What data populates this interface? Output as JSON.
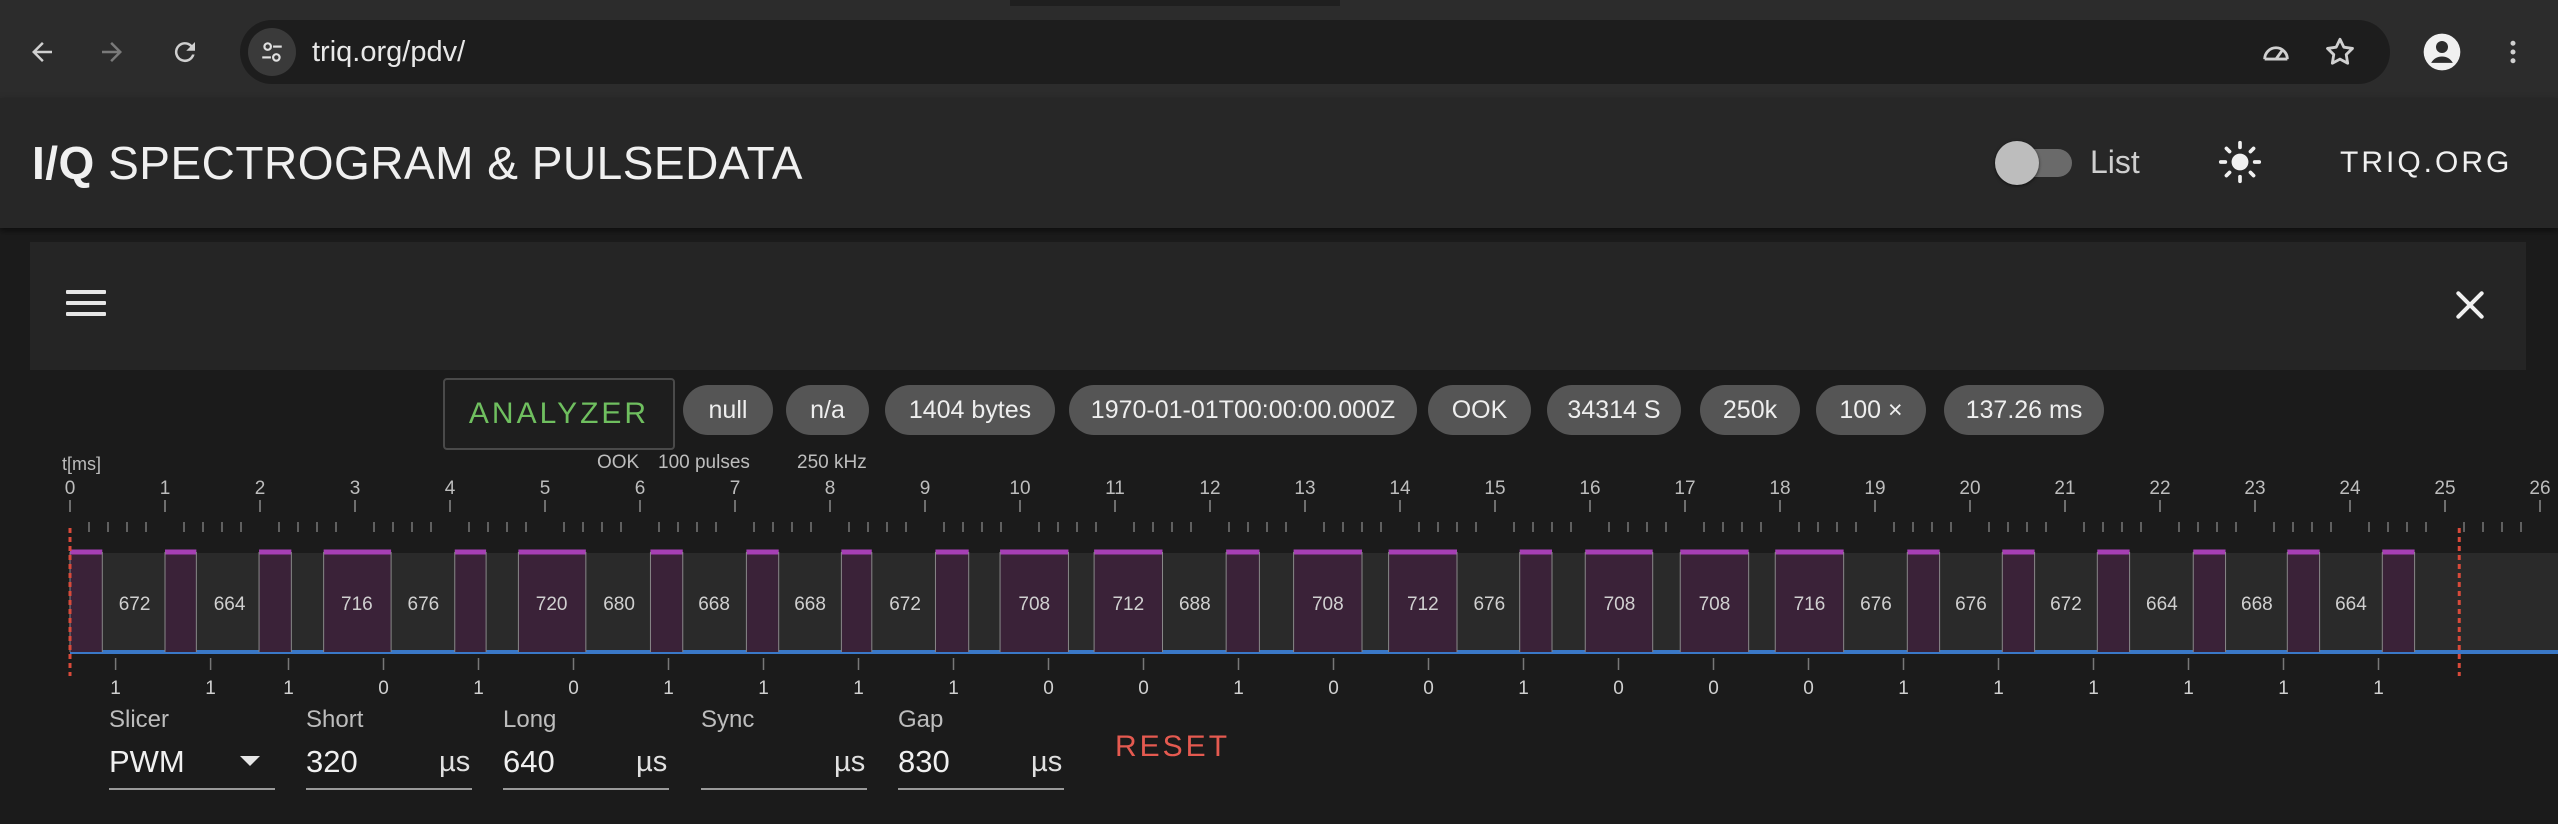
{
  "browser": {
    "url": "triq.org/pdv/"
  },
  "app": {
    "title_bold": "I/Q",
    "title_rest": " SPECTROGRAM & PULSEDATA",
    "list_label": "List",
    "brand": "TRIQ.ORG"
  },
  "analyzer": {
    "label": "ANALYZER"
  },
  "chips": [
    "null",
    "n/a",
    "1404 bytes",
    "1970-01-01T00:00:00.000Z",
    "OOK",
    "34314 S",
    "250k",
    "100 ×",
    "137.26 ms"
  ],
  "chart_header": {
    "axis_label": "t[ms]",
    "modulation": "OOK",
    "pulses": "100 pulses",
    "rate": "250 kHz"
  },
  "chart_data": {
    "type": "timeline",
    "xlabel": "t[ms]",
    "xlim": [
      0,
      26
    ],
    "ticks": [
      "0",
      "1",
      "2",
      "3",
      "4",
      "5",
      "6",
      "7",
      "8",
      "9",
      "10",
      "11",
      "12",
      "13",
      "14",
      "15",
      "16",
      "17",
      "18",
      "19",
      "20",
      "21",
      "22",
      "23",
      "24",
      "25",
      "26"
    ],
    "pulses": [
      {
        "start": 0.0,
        "end": 0.34
      },
      {
        "start": 1.0,
        "end": 1.33
      },
      {
        "start": 1.99,
        "end": 2.33
      },
      {
        "start": 2.67,
        "end": 3.38
      },
      {
        "start": 4.05,
        "end": 4.38
      },
      {
        "start": 4.72,
        "end": 5.43
      },
      {
        "start": 6.11,
        "end": 6.45
      },
      {
        "start": 7.12,
        "end": 7.46
      },
      {
        "start": 8.12,
        "end": 8.44
      },
      {
        "start": 9.11,
        "end": 9.46
      },
      {
        "start": 9.79,
        "end": 10.51
      },
      {
        "start": 10.78,
        "end": 11.5
      },
      {
        "start": 12.17,
        "end": 12.52
      },
      {
        "start": 12.88,
        "end": 13.6
      },
      {
        "start": 13.88,
        "end": 14.6
      },
      {
        "start": 15.26,
        "end": 15.6
      },
      {
        "start": 15.95,
        "end": 16.66
      },
      {
        "start": 16.95,
        "end": 17.67
      },
      {
        "start": 17.95,
        "end": 18.67
      },
      {
        "start": 19.34,
        "end": 19.68
      },
      {
        "start": 20.34,
        "end": 20.68
      },
      {
        "start": 21.34,
        "end": 21.68
      },
      {
        "start": 22.35,
        "end": 22.69
      },
      {
        "start": 23.34,
        "end": 23.68
      },
      {
        "start": 24.34,
        "end": 24.68
      }
    ],
    "gaps": [
      {
        "at": 0.68,
        "label": "672"
      },
      {
        "at": 1.68,
        "label": "664"
      },
      {
        "at": 3.02,
        "label": "716"
      },
      {
        "at": 3.72,
        "label": "676"
      },
      {
        "at": 5.07,
        "label": "720"
      },
      {
        "at": 5.78,
        "label": "680"
      },
      {
        "at": 6.78,
        "label": "668"
      },
      {
        "at": 7.79,
        "label": "668"
      },
      {
        "at": 8.79,
        "label": "672"
      },
      {
        "at": 10.15,
        "label": "708"
      },
      {
        "at": 11.14,
        "label": "712"
      },
      {
        "at": 11.84,
        "label": "688"
      },
      {
        "at": 13.24,
        "label": "708"
      },
      {
        "at": 14.24,
        "label": "712"
      },
      {
        "at": 14.94,
        "label": "676"
      },
      {
        "at": 16.31,
        "label": "708"
      },
      {
        "at": 17.31,
        "label": "708"
      },
      {
        "at": 18.31,
        "label": "716"
      },
      {
        "at": 19.01,
        "label": "676"
      },
      {
        "at": 20.01,
        "label": "676"
      },
      {
        "at": 21.01,
        "label": "672"
      },
      {
        "at": 22.02,
        "label": "664"
      },
      {
        "at": 23.02,
        "label": "668"
      },
      {
        "at": 24.01,
        "label": "664"
      }
    ],
    "bits": [
      {
        "at": 0.48,
        "bit": "1"
      },
      {
        "at": 1.48,
        "bit": "1"
      },
      {
        "at": 2.3,
        "bit": "1"
      },
      {
        "at": 3.3,
        "bit": "0"
      },
      {
        "at": 4.3,
        "bit": "1"
      },
      {
        "at": 5.3,
        "bit": "0"
      },
      {
        "at": 6.3,
        "bit": "1"
      },
      {
        "at": 7.3,
        "bit": "1"
      },
      {
        "at": 8.3,
        "bit": "1"
      },
      {
        "at": 9.3,
        "bit": "1"
      },
      {
        "at": 10.3,
        "bit": "0"
      },
      {
        "at": 11.3,
        "bit": "0"
      },
      {
        "at": 12.3,
        "bit": "1"
      },
      {
        "at": 13.3,
        "bit": "0"
      },
      {
        "at": 14.3,
        "bit": "0"
      },
      {
        "at": 15.3,
        "bit": "1"
      },
      {
        "at": 16.3,
        "bit": "0"
      },
      {
        "at": 17.3,
        "bit": "0"
      },
      {
        "at": 18.3,
        "bit": "0"
      },
      {
        "at": 19.3,
        "bit": "1"
      },
      {
        "at": 20.3,
        "bit": "1"
      },
      {
        "at": 21.3,
        "bit": "1"
      },
      {
        "at": 22.3,
        "bit": "1"
      },
      {
        "at": 23.3,
        "bit": "1"
      },
      {
        "at": 24.3,
        "bit": "1"
      }
    ],
    "markers": [
      0,
      25.15
    ]
  },
  "controls": {
    "slicer": {
      "label": "Slicer",
      "value": "PWM"
    },
    "short": {
      "label": "Short",
      "value": "320",
      "unit": "µs"
    },
    "long": {
      "label": "Long",
      "value": "640",
      "unit": "µs"
    },
    "sync": {
      "label": "Sync",
      "value": "",
      "unit": "µs"
    },
    "gap": {
      "label": "Gap",
      "value": "830",
      "unit": "µs"
    },
    "reset_label": "RESET"
  },
  "colors": {
    "pulse_fill": "#3a2238",
    "pulse_top": "#a63fb4",
    "baseline": "#3a78c7",
    "marker": "#d84a3a",
    "analyzer_text": "#6fbf5f",
    "reset_text": "#e55a50"
  }
}
